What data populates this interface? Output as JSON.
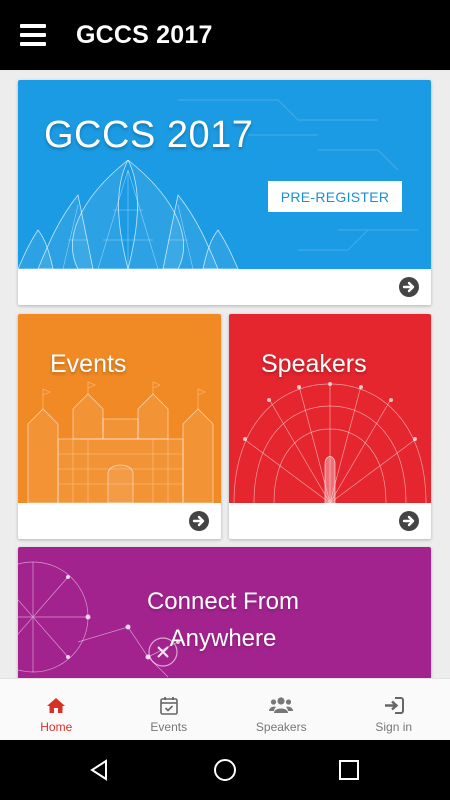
{
  "app_bar": {
    "title": "GCCS 2017",
    "menu_icon": "hamburger-menu-icon"
  },
  "cards": {
    "hero": {
      "title": "GCCS 2017",
      "button_label": "PRE-REGISTER",
      "background": "#1b9be3",
      "arrow_icon": "arrow-circle-right-icon"
    },
    "events": {
      "title": "Events",
      "background": "#f18a25",
      "arrow_icon": "arrow-circle-right-icon"
    },
    "speakers": {
      "title": "Speakers",
      "background": "#e5262f",
      "arrow_icon": "arrow-circle-right-icon"
    },
    "connect": {
      "title_line1": "Connect From",
      "title_line2": "Anywhere",
      "background": "#a3238e"
    }
  },
  "bottom_nav": {
    "active": "Home",
    "active_color": "#d93025",
    "items": [
      {
        "label": "Home",
        "icon": "home-icon"
      },
      {
        "label": "Events",
        "icon": "calendar-check-icon"
      },
      {
        "label": "Speakers",
        "icon": "users-icon"
      },
      {
        "label": "Sign in",
        "icon": "sign-in-icon"
      }
    ]
  },
  "system_nav": {
    "buttons": [
      "back-icon",
      "home-circle-icon",
      "recents-icon"
    ]
  }
}
